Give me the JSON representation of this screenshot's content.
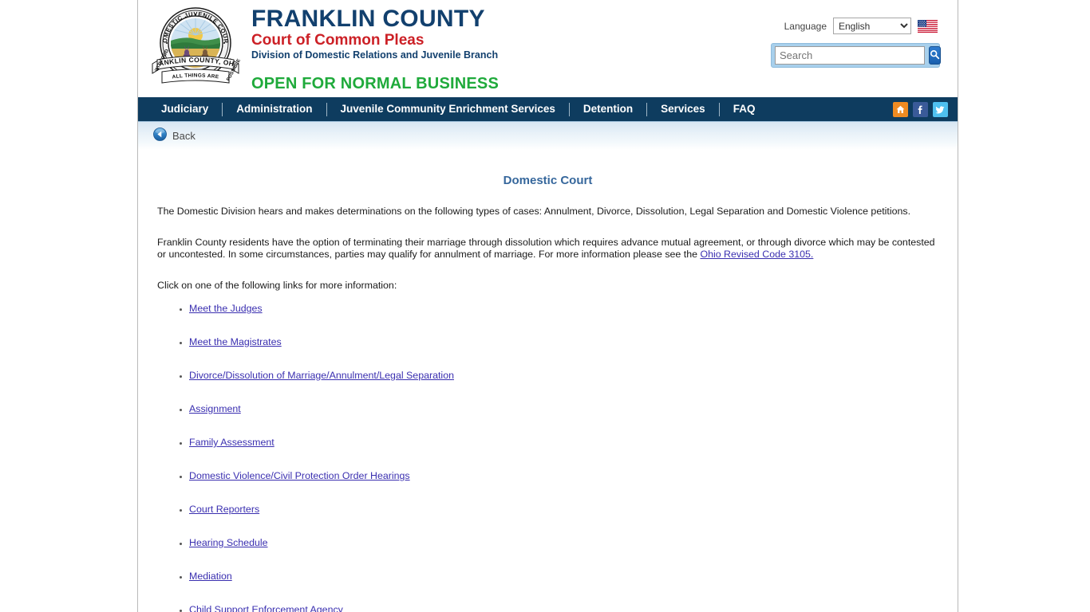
{
  "header": {
    "seal": {
      "top_text": "DOMESTIC JUVENILE COURT",
      "banner_text": "FRANKLIN COUNTY, OHIO",
      "motto_left": "WITH GOD",
      "motto_center": "ALL THINGS ARE",
      "motto_right": "POSSIBLE"
    },
    "brand_line1": "FRANKLIN COUNTY",
    "brand_line2": "Court of Common Pleas",
    "brand_line3": "Division of Domestic Relations and Juvenile Branch",
    "open_notice": "OPEN FOR NORMAL BUSINESS",
    "language_label": "Language",
    "language_value": "English",
    "language_options": [
      "English"
    ],
    "flag_icon": "us-flag-icon",
    "search_placeholder": "Search",
    "search_value": "",
    "search_icon": "magnifier-icon"
  },
  "nav": {
    "items": [
      {
        "label": "Judiciary"
      },
      {
        "label": "Administration"
      },
      {
        "label": "Juvenile Community Enrichment Services"
      },
      {
        "label": "Detention"
      },
      {
        "label": "Services"
      },
      {
        "label": "FAQ"
      }
    ],
    "icons": [
      {
        "name": "home-icon",
        "glyph": "⌂"
      },
      {
        "name": "facebook-icon",
        "glyph": "f"
      },
      {
        "name": "twitter-icon",
        "glyph": "t"
      }
    ]
  },
  "backbar": {
    "label": "Back",
    "icon": "back-arrow-icon"
  },
  "main": {
    "title": "Domestic Court",
    "paragraph1": "The Domestic Division hears and makes determinations on the following types of cases: Annulment, Divorce, Dissolution, Legal Separation and Domestic Violence petitions.",
    "paragraph2_before": "Franklin County residents have the option of terminating their marriage through dissolution which requires advance mutual agreement, or through divorce which may be contested or uncontested. In some circumstances, parties may qualify for annulment of marriage. For more information please see the ",
    "paragraph2_link": "Ohio Revised Code 3105.",
    "paragraph3": "Click on one of the following links for more information:",
    "links": [
      {
        "label": "Meet the Judges"
      },
      {
        "label": "Meet the Magistrates"
      },
      {
        "label": "Divorce/Dissolution of Marriage/Annulment/Legal Separation"
      },
      {
        "label": "Assignment"
      },
      {
        "label": "Family Assessment"
      },
      {
        "label": "Domestic Violence/Civil Protection Order Hearings"
      },
      {
        "label": "Court Reporters"
      },
      {
        "label": "Hearing Schedule"
      },
      {
        "label": "Mediation"
      },
      {
        "label": "Child Support Enforcement Agency"
      }
    ]
  },
  "colors": {
    "brand_navy": "#12406e",
    "brand_red": "#cc2026",
    "open_green": "#1faa3b",
    "nav_bg": "#0e3c5f",
    "title_blue": "#36679c",
    "link_purple": "#3a2fb0",
    "search_bg": "#a8d0ec",
    "home_orange": "#ef8b22",
    "facebook_blue": "#3a5a98",
    "twitter_blue": "#4fc0ef"
  }
}
